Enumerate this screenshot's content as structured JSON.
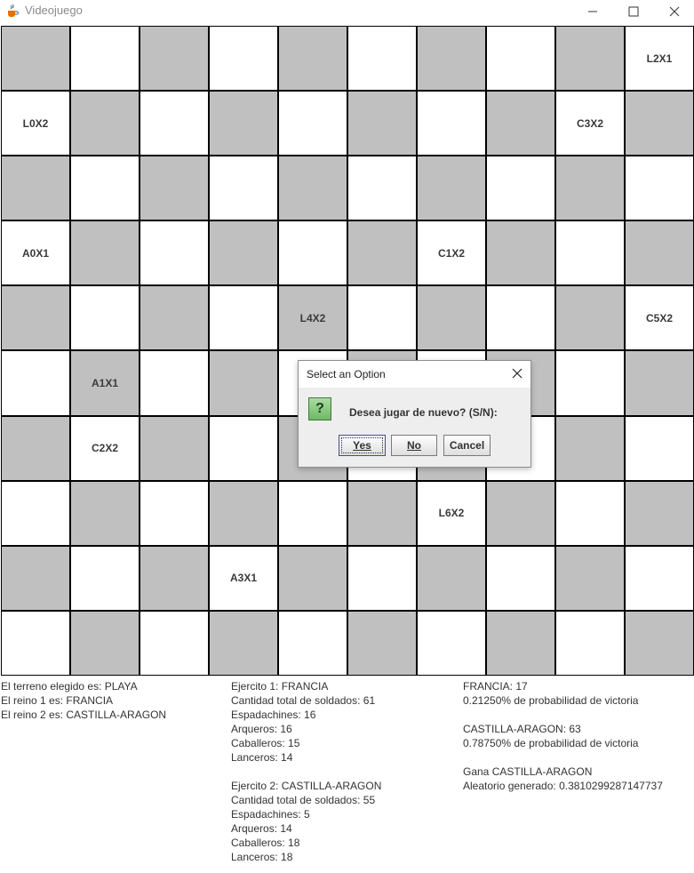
{
  "window": {
    "title": "Videojuego",
    "icons": {
      "app": "java-cup-icon",
      "minimize": "minimize-icon",
      "maximize": "maximize-icon",
      "close": "close-icon"
    }
  },
  "board": {
    "cells": [
      "",
      "",
      "",
      "",
      "",
      "",
      "",
      "",
      "",
      "L2X1",
      "L0X2",
      "",
      "",
      "",
      "",
      "",
      "",
      "",
      "C3X2",
      "",
      "",
      "",
      "",
      "",
      "",
      "",
      "",
      "",
      "",
      "",
      "A0X1",
      "",
      "",
      "",
      "",
      "",
      "C1X2",
      "",
      "",
      "",
      "",
      "",
      "",
      "",
      "L4X2",
      "",
      "",
      "",
      "",
      "C5X2",
      "",
      "A1X1",
      "",
      "",
      "",
      "",
      "",
      "",
      "",
      "",
      "",
      "C2X2",
      "",
      "",
      "",
      "",
      "",
      "",
      "",
      "",
      "",
      "",
      "",
      "",
      "",
      "",
      "L6X2",
      "",
      "",
      "",
      "",
      "",
      "",
      "A3X1",
      "",
      "",
      "",
      "",
      "",
      "",
      "",
      "",
      "",
      "",
      "",
      "",
      "",
      "",
      "",
      ""
    ],
    "colors": {
      "dark": "#c0c0c0",
      "light": "#ffffff",
      "grid": "#000000"
    }
  },
  "info": {
    "col1": [
      "El terreno elegido es: PLAYA",
      "El reino 1 es: FRANCIA",
      "El reino 2 es: CASTILLA-ARAGON"
    ],
    "col2": [
      "Ejercito 1: FRANCIA",
      "Cantidad total de soldados: 61",
      "Espadachines: 16",
      "Arqueros: 16",
      "Caballeros: 15",
      "Lanceros: 14",
      "",
      "Ejercito 2: CASTILLA-ARAGON",
      "Cantidad total de soldados: 55",
      "Espadachines: 5",
      "Arqueros: 14",
      "Caballeros: 18",
      "Lanceros: 18"
    ],
    "col3": [
      "FRANCIA: 17",
      "0.21250% de probabilidad de victoria",
      "",
      "CASTILLA-ARAGON: 63",
      "0.78750% de probabilidad de victoria",
      "",
      "Gana CASTILLA-ARAGON",
      "Aleatorio generado: 0.3810299287147737"
    ]
  },
  "dialog": {
    "title": "Select an Option",
    "message": "Desea jugar de nuevo? (S/N):",
    "icon": "question-icon",
    "icon_glyph": "?",
    "buttons": {
      "yes": "Yes",
      "no": "No",
      "cancel": "Cancel"
    }
  }
}
